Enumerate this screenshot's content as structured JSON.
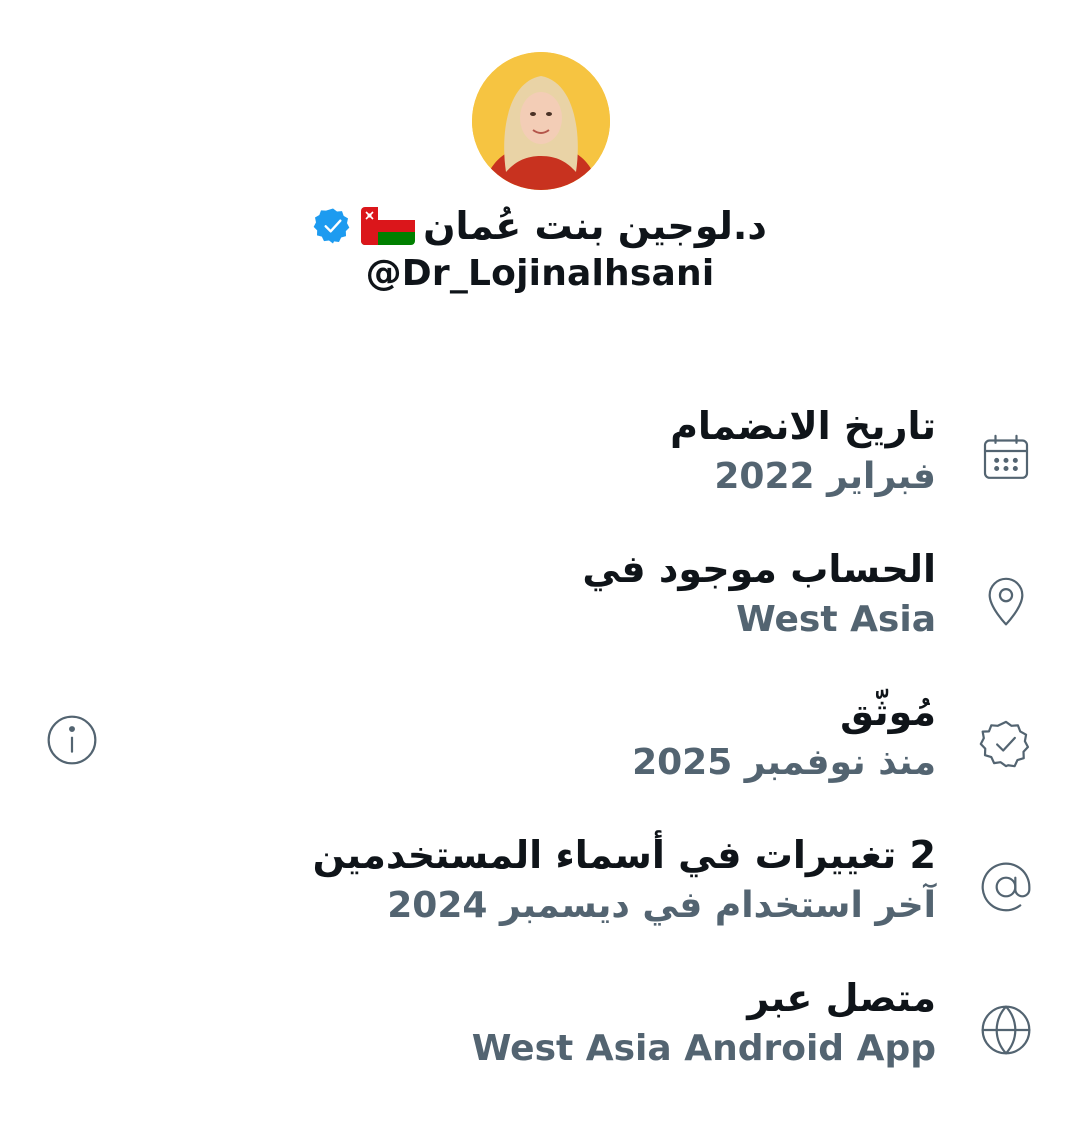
{
  "profile": {
    "display_name": "د.لوجين بنت عُمان",
    "handle": "@Dr_Lojinalhsani",
    "flag_icon": "oman-flag-icon",
    "verified_icon": "verified-badge-icon",
    "verified_color": "#1d9bf0"
  },
  "about": {
    "items": [
      {
        "icon": "calendar-icon",
        "title": "تاريخ الانضمام",
        "value": "فبراير 2022"
      },
      {
        "icon": "location-pin-icon",
        "title": "الحساب موجود في",
        "value": "West Asia"
      },
      {
        "icon": "verified-seal-icon",
        "title": "مُوثّق",
        "value": "منذ نوفمبر 2025",
        "extra_icon": "info-icon"
      },
      {
        "icon": "at-sign-icon",
        "title": "2 تغييرات في أسماء المستخدمين",
        "value": "آخر استخدام في ديسمبر 2024"
      },
      {
        "icon": "globe-icon",
        "title": "متصل عبر",
        "value": "West Asia Android App"
      }
    ]
  },
  "colors": {
    "primary_text": "#0f1419",
    "secondary_text": "#536471",
    "accent": "#1d9bf0",
    "icon": "#536471"
  }
}
